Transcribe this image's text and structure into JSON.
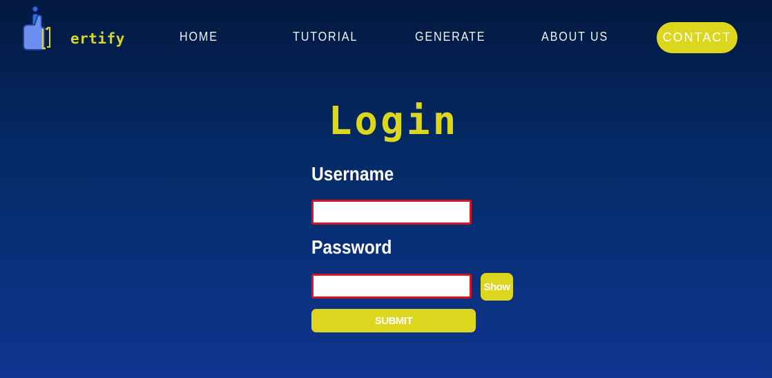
{
  "brand": {
    "logo_text": "ertify"
  },
  "nav": {
    "items": [
      "HOME",
      "TUTORIAL",
      "GENERATE",
      "ABOUT US"
    ],
    "contact_label": "CONTACT"
  },
  "login": {
    "title": "Login",
    "username_label": "Username",
    "username_value": "",
    "password_label": "Password",
    "password_value": "",
    "show_label": "Show",
    "submit_label": "SUBMIT"
  },
  "colors": {
    "accent": "#dcd61f",
    "input_border": "#d8141e",
    "bg_top": "#03183f",
    "bg_bottom": "#0f3590"
  },
  "icons": {
    "logo": "thumbs-up-icon"
  }
}
